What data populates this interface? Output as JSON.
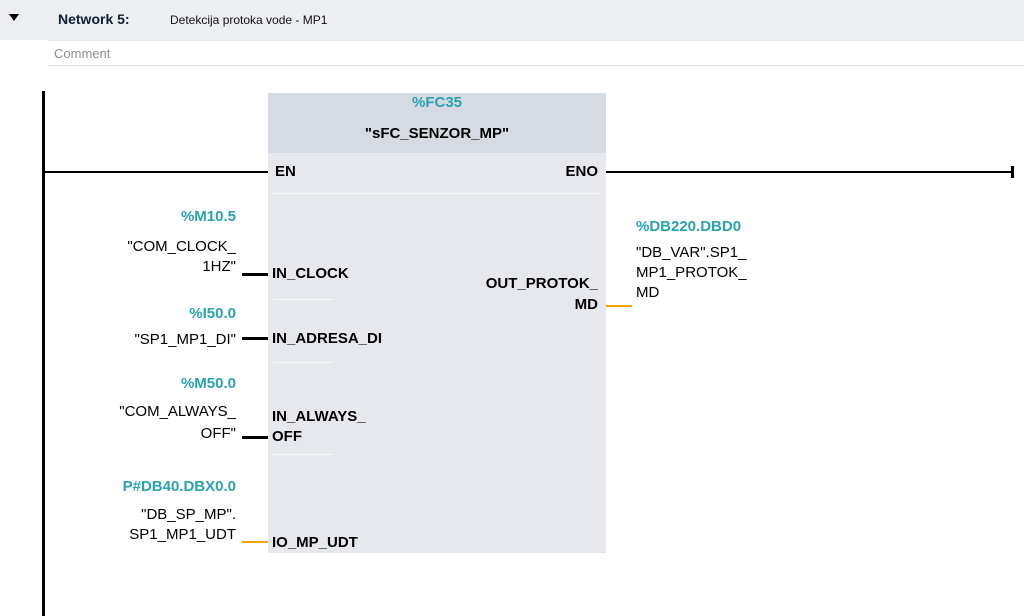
{
  "network": {
    "title": "Network 5:",
    "description": "Detekcija protoka vode - MP1",
    "comment_placeholder": "Comment"
  },
  "block": {
    "address": "%FC35",
    "name": "\"sFC_SENZOR_MP\"",
    "pins": {
      "en": "EN",
      "eno": "ENO",
      "in_clock": "IN_CLOCK",
      "in_adresa_di": "IN_ADRESA_DI",
      "in_always_1": "IN_ALWAYS_",
      "in_always_2": "OFF",
      "io_mp_udt": "IO_MP_UDT",
      "out_protok_1": "OUT_PROTOK_",
      "out_protok_2": "MD"
    }
  },
  "operands": {
    "clock": {
      "address": "%M10.5",
      "symbol_1": "\"COM_CLOCK_",
      "symbol_2": "1HZ\""
    },
    "adresa": {
      "address": "%I50.0",
      "symbol_1": "\"SP1_MP1_DI\""
    },
    "always": {
      "address": "%M50.0",
      "symbol_1": "\"COM_ALWAYS_",
      "symbol_2": "OFF\""
    },
    "udt": {
      "address": "P#DB40.DBX0.0",
      "symbol_1": "\"DB_SP_MP\".",
      "symbol_2": "SP1_MP1_UDT"
    },
    "protok": {
      "address": "%DB220.DBD0",
      "symbol_1": "\"DB_VAR\".SP1_",
      "symbol_2": "MP1_PROTOK_",
      "symbol_3": "MD"
    }
  },
  "colors": {
    "address": "#2aa2b0",
    "block_body": "#e6e8ee",
    "block_header": "#d6dae2",
    "wire_bool": "#000000",
    "wire_data": "#f0a30a"
  }
}
